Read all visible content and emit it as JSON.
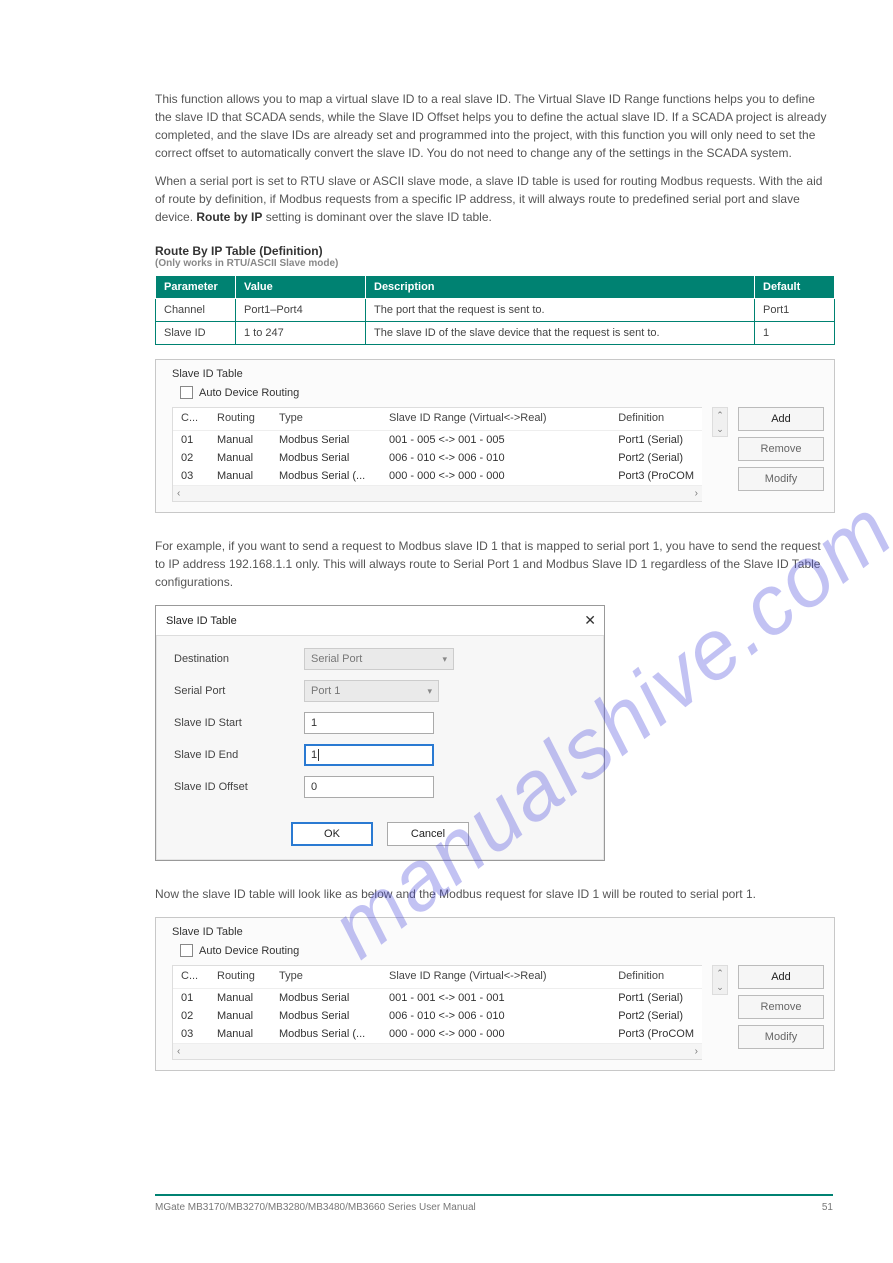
{
  "intro": {
    "p1": "This function allows you to map a virtual slave ID to a real slave ID. The Virtual Slave ID Range functions helps you to define the slave ID that SCADA sends, while the Slave ID Offset helps you to define the actual slave ID. If a SCADA project is already completed, and the slave IDs are already set and programmed into the project, with this function you will only need to set the correct offset to automatically convert the slave ID. You do not need to change any of the settings in the SCADA system.",
    "p2_prefix": "When a serial port is set to RTU slave or ASCII slave mode, a slave ID table is used for routing Modbus requests. With the aid of route by definition, if Modbus requests from a specific IP address, it will always route to predefined serial port and slave device. ",
    "p2_bold": "Route by IP",
    "p2_suffix": " setting is dominant over the slave ID table."
  },
  "routebyip_table": {
    "title": "Route By IP Table (Definition)",
    "note": "(Only works in RTU/ASCII Slave mode)",
    "headers": [
      "Parameter",
      "Value",
      "Description",
      "Default"
    ],
    "rows": [
      [
        "Channel",
        "Port1–Port4",
        "The port that the request is sent to.",
        "Port1"
      ],
      [
        "Slave ID",
        "1 to 247",
        "The slave ID of the slave device that the request is sent to.",
        "1"
      ]
    ]
  },
  "panel_common": {
    "title": "Slave ID Table",
    "checkbox": "Auto Device Routing",
    "columns": [
      "C...",
      "Routing",
      "Type",
      "Slave ID Range (Virtual<->Real)",
      "Definition"
    ],
    "buttons": {
      "add": "Add",
      "remove": "Remove",
      "modify": "Modify"
    }
  },
  "panel1_rows": [
    [
      "01",
      "Manual",
      "Modbus Serial",
      "001 - 005 <-> 001 - 005",
      "Port1 (Serial)"
    ],
    [
      "02",
      "Manual",
      "Modbus Serial",
      "006 - 010 <-> 006 - 010",
      "Port2 (Serial)"
    ],
    [
      "03",
      "Manual",
      "Modbus Serial (...",
      "000 - 000 <-> 000 - 000",
      "Port3 (ProCOM"
    ]
  ],
  "mid_para": "For example, if you want to send a request to Modbus slave ID 1 that is mapped to serial port 1, you have to send the request to IP address 192.168.1.1 only. This will always route to Serial Port 1 and Modbus Slave ID 1 regardless of the Slave ID Table configurations.",
  "dialog": {
    "title": "Slave ID Table",
    "labels": {
      "dest": "Destination",
      "serial": "Serial Port",
      "start": "Slave ID Start",
      "end": "Slave ID End",
      "offset": "Slave ID Offset"
    },
    "values": {
      "dest": "Serial Port",
      "serial": "Port 1",
      "start": "1",
      "end": "1",
      "offset": "0"
    },
    "ok": "OK",
    "cancel": "Cancel"
  },
  "after_dialog": "Now the slave ID table will look like as below and the Modbus request for slave ID 1 will be routed to serial port 1.",
  "panel2_rows": [
    [
      "01",
      "Manual",
      "Modbus Serial",
      "001 - 001 <-> 001 - 001",
      "Port1 (Serial)"
    ],
    [
      "02",
      "Manual",
      "Modbus Serial",
      "006 - 010 <-> 006 - 010",
      "Port2 (Serial)"
    ],
    [
      "03",
      "Manual",
      "Modbus Serial (...",
      "000 - 000 <-> 000 - 000",
      "Port3 (ProCOM"
    ]
  ],
  "watermark": "manualshive.com",
  "footer": {
    "left": "MGate MB3170/MB3270/MB3280/MB3480/MB3660 Series User Manual",
    "right": "51"
  }
}
